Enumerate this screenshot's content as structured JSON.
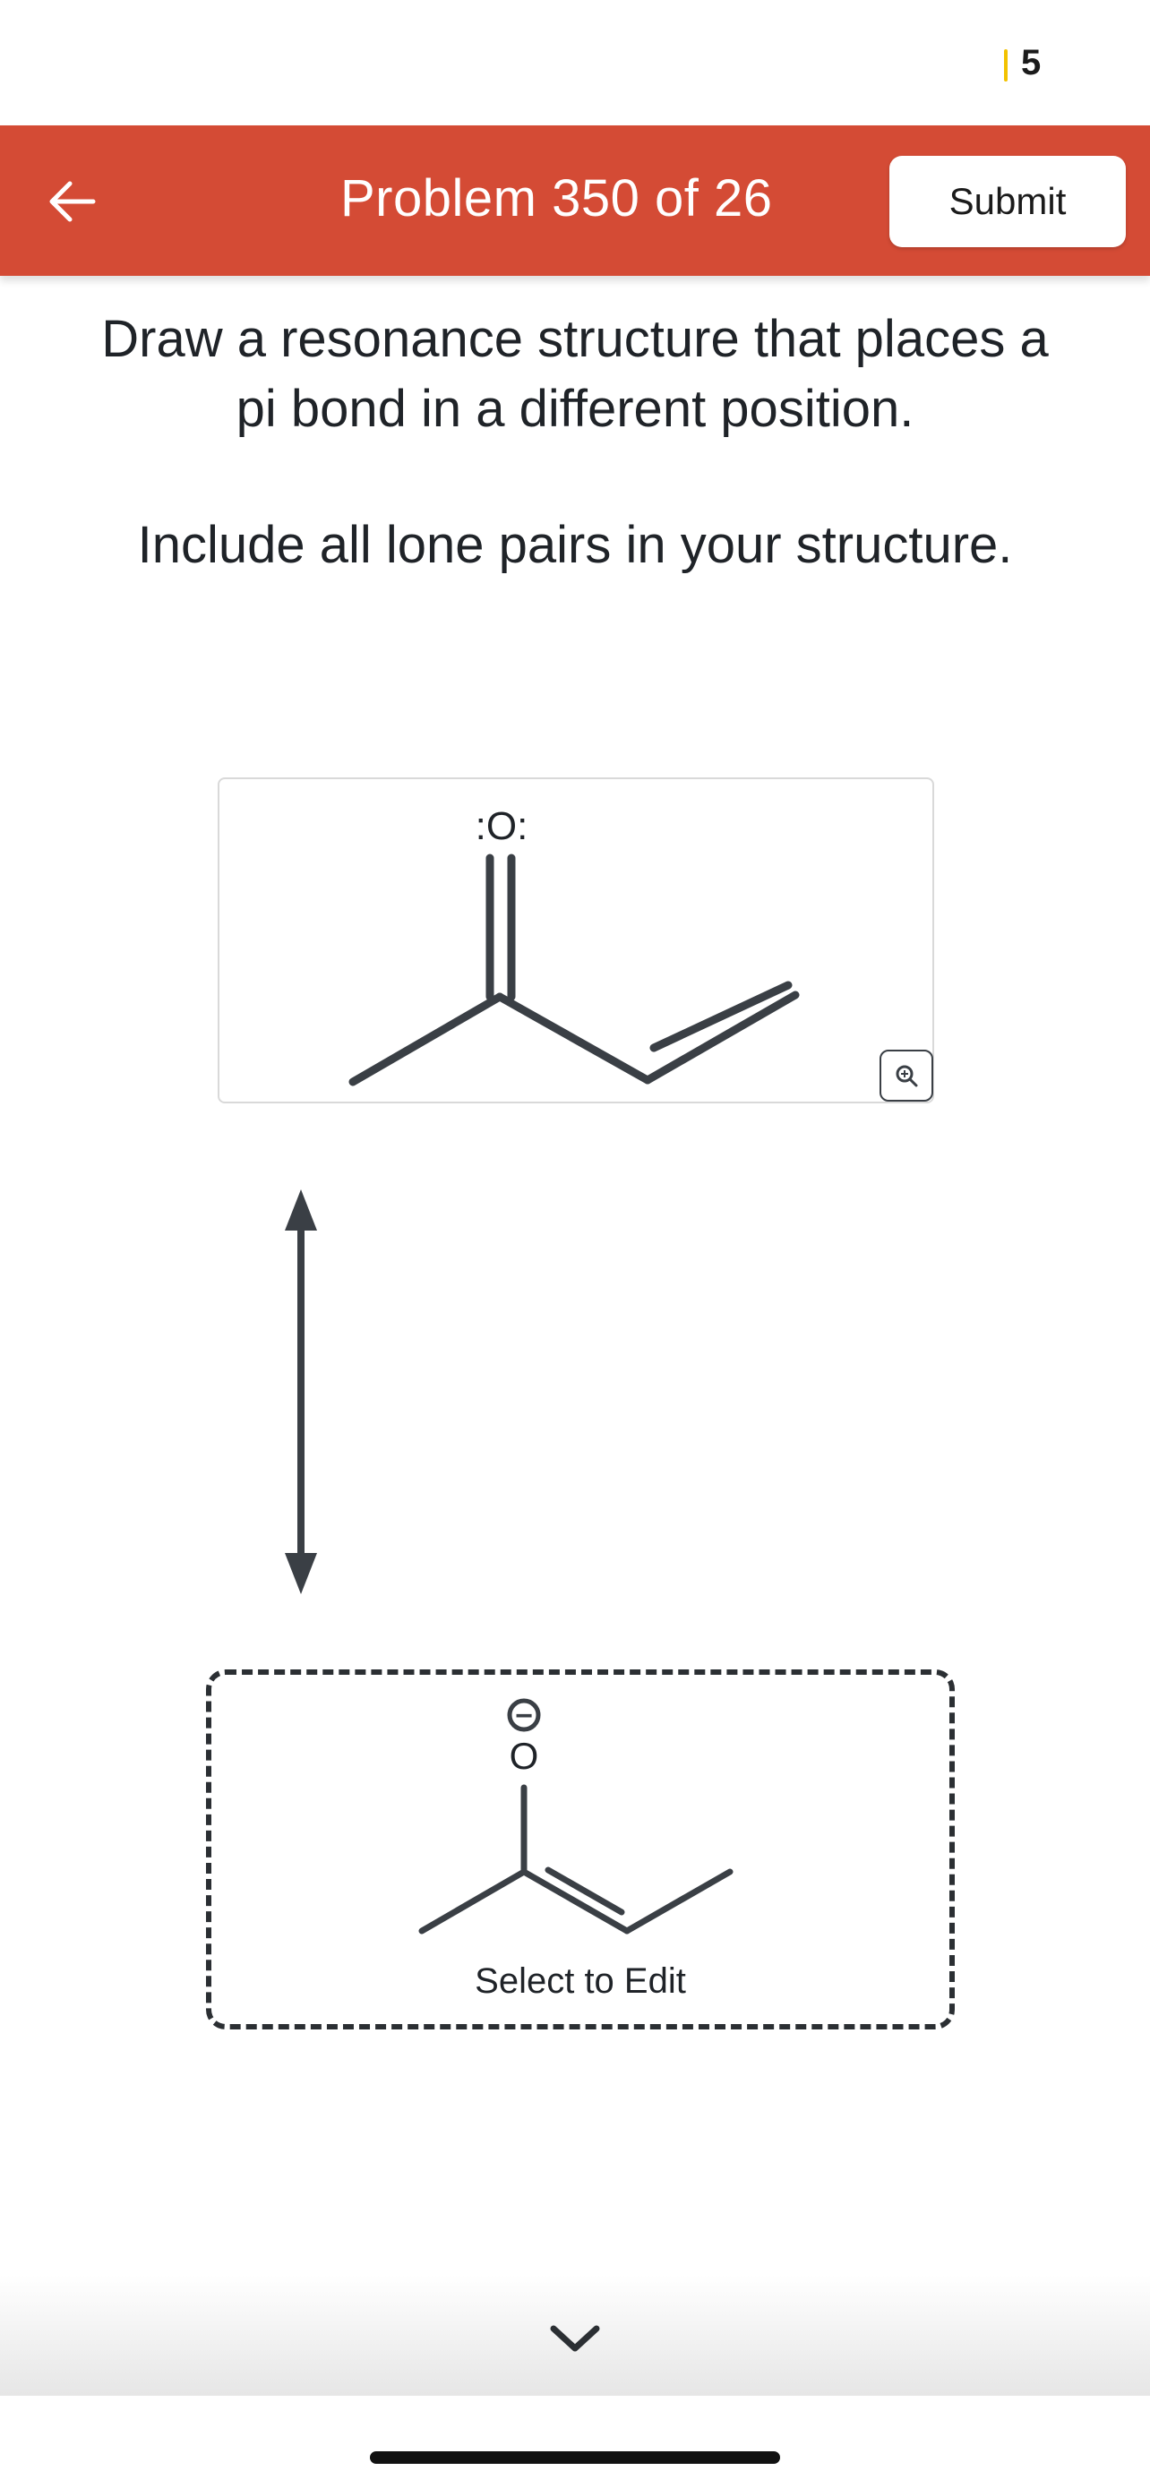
{
  "status": {
    "count": "5"
  },
  "header": {
    "title": "Problem 350 of 26",
    "submit_label": "Submit",
    "back_icon": "arrow-left-icon"
  },
  "question": {
    "prompt_line_1": "Draw a resonance structure that places a",
    "prompt_line_2": "pi bond in a different position.",
    "instruction": "Include all lone pairs in your structure."
  },
  "given_structure": {
    "oxygen_label": ":O:",
    "zoom_icon": "zoom-in-icon"
  },
  "answer": {
    "oxygen_label": "O",
    "charge_symbol": "−",
    "select_label": "Select to Edit"
  },
  "footer": {
    "chevron_icon": "chevron-down-icon"
  },
  "colors": {
    "header_bg": "#d44b35",
    "bond_color": "#3a3f45",
    "status_accent": "#f2c200"
  }
}
